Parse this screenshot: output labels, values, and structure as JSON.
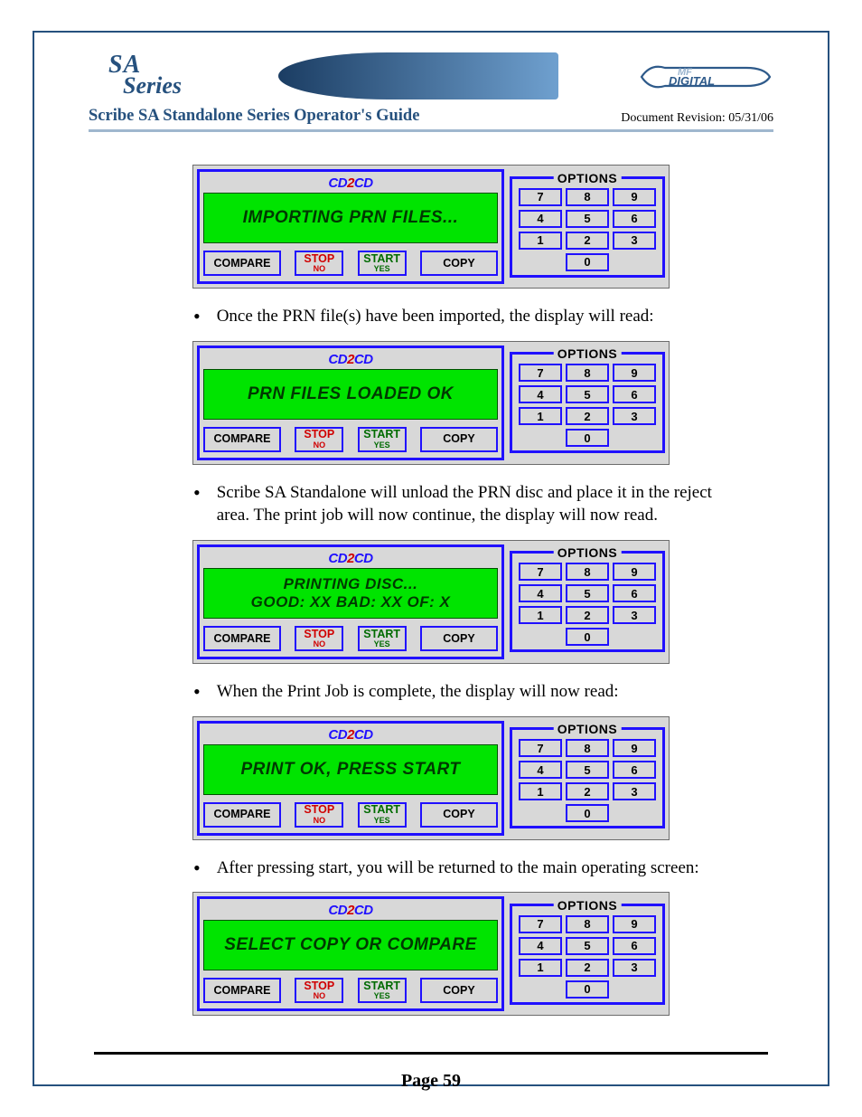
{
  "header": {
    "logo_sa": "SA",
    "logo_series": "Series",
    "title": "Scribe SA Standalone Series Operator's Guide",
    "revision": "Document Revision: 05/31/06",
    "mf_top": "MF",
    "mf_bottom": "DIGITAL"
  },
  "bullets": [
    "Once the PRN file(s) have been imported, the display will read:",
    "Scribe SA Standalone will unload the PRN disc and place it in the reject area.  The print job will now continue, the display will now read.",
    "When the Print Job is complete, the display will now read:",
    "After pressing start, you will be returned to the main operating screen:"
  ],
  "panel": {
    "cd_left": "CD",
    "cd_two": "2",
    "cd_right": "CD",
    "compare": "COMPARE",
    "stop": "STOP",
    "stop_sub": "NO",
    "start": "START",
    "start_sub": "YES",
    "copy": "COPY",
    "options": "OPTIONS",
    "keys": [
      "7",
      "8",
      "9",
      "4",
      "5",
      "6",
      "1",
      "2",
      "3",
      "0"
    ]
  },
  "lcd": [
    {
      "lines": [
        "IMPORTING PRN FILES..."
      ]
    },
    {
      "lines": [
        "PRN FILES LOADED OK"
      ]
    },
    {
      "lines": [
        "PRINTING DISC...",
        "GOOD: XX  BAD: XX  OF: X"
      ]
    },
    {
      "lines": [
        "PRINT OK, PRESS START"
      ]
    },
    {
      "lines": [
        "SELECT COPY OR COMPARE"
      ]
    }
  ],
  "footer": {
    "page": "Page 59"
  }
}
